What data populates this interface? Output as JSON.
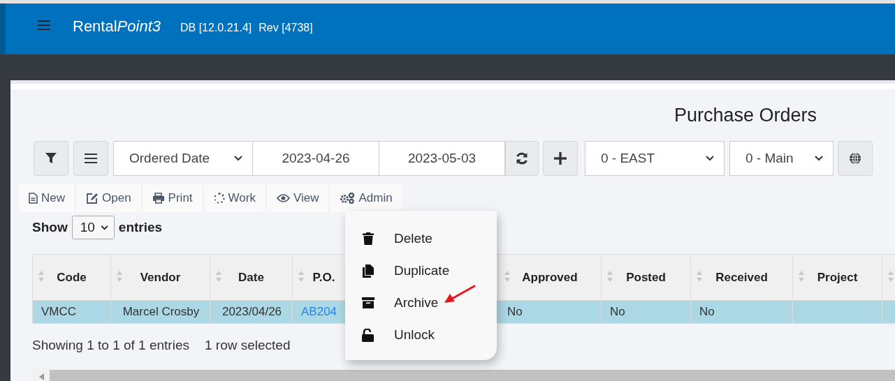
{
  "header": {
    "brand": "Rental",
    "brand_accent": "Point3",
    "db": "DB [12.0.21.4]",
    "rev": "Rev [4738]"
  },
  "page_title": "Purchase Orders",
  "filters": {
    "date_field": "Ordered Date",
    "date_from": "2023-04-26",
    "date_to": "2023-05-03",
    "region": "0 - EAST",
    "location": "0 - Main"
  },
  "actions": [
    {
      "label": "New",
      "kind": "file"
    },
    {
      "label": "Open",
      "kind": "edit"
    },
    {
      "label": "Print",
      "kind": "print"
    },
    {
      "label": "Work",
      "kind": "spinner"
    },
    {
      "label": "View",
      "kind": "eye"
    },
    {
      "label": "Admin",
      "kind": "gears"
    }
  ],
  "length": {
    "before": "Show",
    "value": "10",
    "after": "entries"
  },
  "table": {
    "columns": [
      {
        "kind": "header",
        "label": "Code"
      },
      {
        "kind": "header",
        "label": "Vendor"
      },
      {
        "kind": "header",
        "label": "Date"
      },
      {
        "kind": "header",
        "label": "P.O."
      },
      {
        "kind": "covered"
      },
      {
        "kind": "header",
        "label": "Approved"
      },
      {
        "kind": "header",
        "label": "Posted"
      },
      {
        "kind": "header",
        "label": "Received"
      },
      {
        "kind": "header",
        "label": "Project"
      },
      {
        "kind": "cut"
      }
    ],
    "rows": [
      {
        "selected": true,
        "cells": [
          {
            "kind": "text",
            "text": "VMCC"
          },
          {
            "kind": "text",
            "text": "Marcel Crosby"
          },
          {
            "kind": "text",
            "text": "2023/04/26"
          },
          {
            "kind": "link",
            "text": "AB204"
          },
          {
            "kind": "empty"
          },
          {
            "kind": "text",
            "text": "No"
          },
          {
            "kind": "text",
            "text": "No"
          },
          {
            "kind": "text",
            "text": "No"
          },
          {
            "kind": "empty"
          },
          {
            "kind": "empty"
          }
        ]
      }
    ]
  },
  "footer": {
    "info": "Showing 1 to 1 of 1 entries",
    "selection": "1 row selected"
  },
  "menu": {
    "items": [
      {
        "label": "Delete",
        "kind": "trash"
      },
      {
        "label": "Duplicate",
        "kind": "copy"
      },
      {
        "label": "Archive",
        "kind": "archive"
      },
      {
        "label": "Unlock",
        "kind": "unlock"
      }
    ]
  }
}
